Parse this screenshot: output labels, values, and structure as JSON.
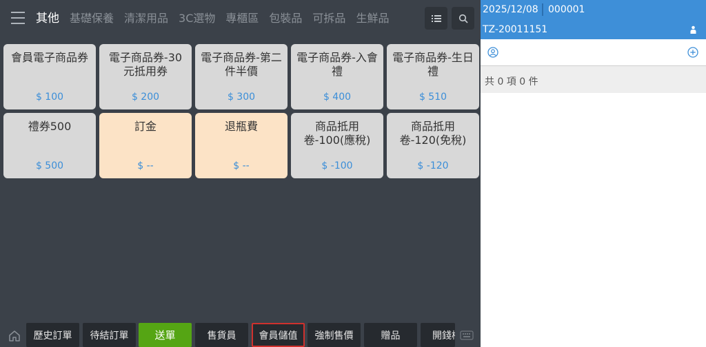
{
  "topbar": {
    "categories": [
      "其他",
      "基礎保養",
      "清潔用品",
      "3C選物",
      "專櫃區",
      "包裝品",
      "可拆品",
      "生鮮品"
    ]
  },
  "products": [
    {
      "name": "會員電子商品券",
      "price": "$ 100",
      "style": "gray"
    },
    {
      "name": "電子商品券-30元抵用券",
      "price": "$ 200",
      "style": "gray"
    },
    {
      "name": "電子商品券-第二件半價",
      "price": "$ 300",
      "style": "gray"
    },
    {
      "name": "電子商品券-入會禮",
      "price": "$ 400",
      "style": "gray"
    },
    {
      "name": "電子商品券-生日禮",
      "price": "$ 510",
      "style": "gray"
    },
    {
      "name": "禮券500",
      "price": "$ 500",
      "style": "gray"
    },
    {
      "name": "訂金",
      "price": "$ --",
      "style": "peach"
    },
    {
      "name": "退瓶費",
      "price": "$ --",
      "style": "peach"
    },
    {
      "name": "商品抵用卷-100(應稅)",
      "price": "$ -100",
      "style": "gray"
    },
    {
      "name": "商品抵用卷-120(免稅)",
      "price": "$ -120",
      "style": "gray"
    }
  ],
  "bottombar": {
    "history": "歷史訂單",
    "pending": "待結訂單",
    "submit": "送單",
    "salesperson": "售貨員",
    "member_topup": "會員儲值",
    "force_price": "強制售價",
    "gift": "贈品",
    "open_drawer": "開錢櫃"
  },
  "order": {
    "date": "2025/12/08",
    "number": "000001",
    "order_id": "TZ-20011151",
    "summary": "共 0 項 0 件"
  },
  "colors": {
    "accent": "#3e8fd8",
    "submit": "#55a514",
    "highlight": "#d0312d",
    "price": "#3b8ed8"
  }
}
